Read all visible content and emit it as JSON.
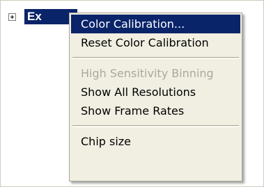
{
  "tree": {
    "node_label": "Ex"
  },
  "context_menu": {
    "items": [
      {
        "label": "Color Calibration...",
        "highlighted": true,
        "disabled": false
      },
      {
        "label": "Reset Color Calibration",
        "highlighted": false,
        "disabled": false
      },
      {
        "label": "High Sensitivity Binning",
        "highlighted": false,
        "disabled": true
      },
      {
        "label": "Show All Resolutions",
        "highlighted": false,
        "disabled": false
      },
      {
        "label": "Show Frame Rates",
        "highlighted": false,
        "disabled": false
      },
      {
        "label": "Chip size",
        "highlighted": false,
        "disabled": false
      }
    ]
  },
  "colors": {
    "highlight": "#0a246a",
    "menu_background": "#f1efe2",
    "disabled_text": "#aca899"
  }
}
